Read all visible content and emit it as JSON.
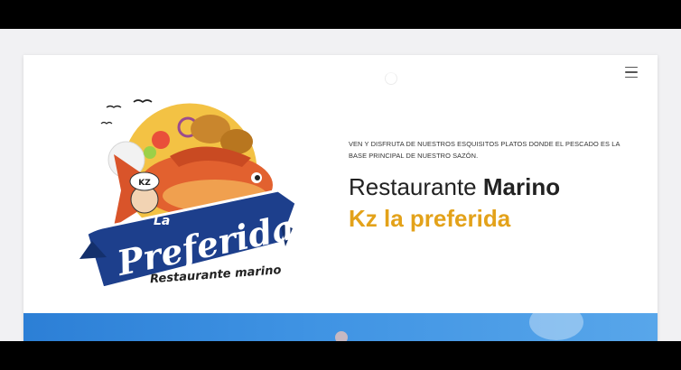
{
  "hero": {
    "tagline": "VEN Y DISFRUTA DE NUESTROS ESQUISITOS PLATOS DONDE EL PESCADO ES LA BASE PRINCIPAL DE NUESTRO SAZÓN.",
    "title_light": "Restaurante ",
    "title_bold": "Marino",
    "subtitle": "Kz la preferida"
  },
  "logo": {
    "badge": "KZ",
    "banner_small": "La",
    "banner_big": "Preferida",
    "caption": "Restaurante marino"
  },
  "colors": {
    "accent": "#e3a21a",
    "banner_blue": "#1d3f8c",
    "hero_blue": "#3f93e3"
  },
  "icons": {
    "menu": "hamburger-menu-icon",
    "loader": "loading-spinner-icon"
  }
}
